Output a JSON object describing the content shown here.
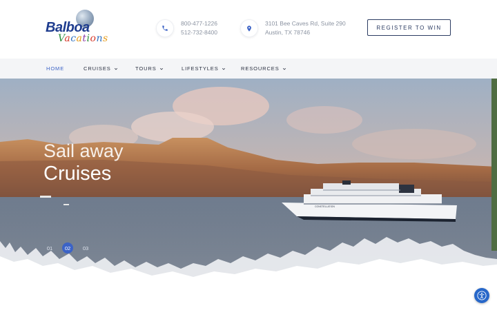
{
  "logo": {
    "brand_line1": "Balboa",
    "brand_line2": "Vacations"
  },
  "header": {
    "phone": {
      "line1": "800-477-1226",
      "line2": "512-732-8400",
      "icon": "phone-icon"
    },
    "address": {
      "line1": "3101 Bee Caves Rd, Suite 290",
      "line2": "Austin, TX 78746",
      "icon": "map-pin-icon"
    },
    "register_label": "REGISTER TO WIN"
  },
  "nav": {
    "items": [
      {
        "label": "HOME",
        "active": true,
        "has_dropdown": false
      },
      {
        "label": "CRUISES",
        "active": false,
        "has_dropdown": true
      },
      {
        "label": "TOURS",
        "active": false,
        "has_dropdown": true
      },
      {
        "label": "LIFESTYLES",
        "active": false,
        "has_dropdown": true
      },
      {
        "label": "RESOURCES",
        "active": false,
        "has_dropdown": true
      }
    ]
  },
  "hero": {
    "pre_title": "Sail away",
    "title": "Cruises",
    "ship_name": "CONSTELLATION",
    "slides": [
      "01",
      "02",
      "03"
    ],
    "active_slide": "02"
  },
  "colors": {
    "accent": "#3c63c6",
    "navy": "#2b3b61",
    "nav_bg": "#f4f5f7",
    "a11y_blue": "#2767c9"
  },
  "accessibility_button": {
    "icon": "accessibility-icon"
  }
}
